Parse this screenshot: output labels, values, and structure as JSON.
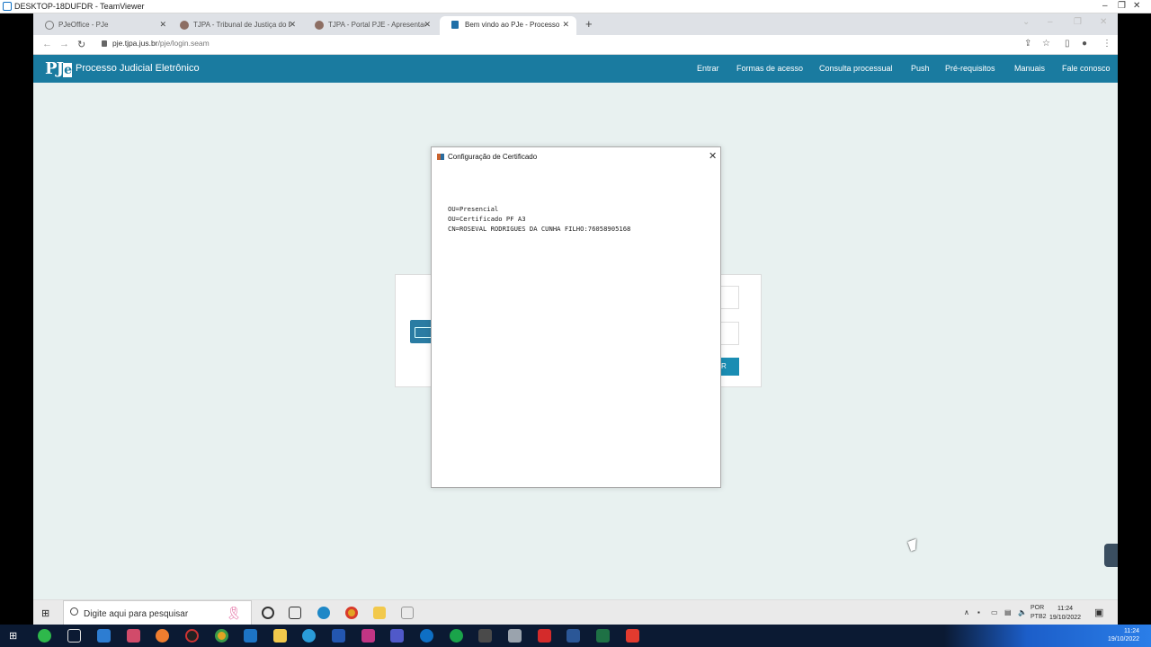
{
  "teamviewer": {
    "title": "DESKTOP-18DUFDR - TeamViewer",
    "controls": [
      "–",
      "❐",
      "✕"
    ]
  },
  "browser": {
    "tabs": [
      {
        "label": "PJeOffice - PJe",
        "favicon": "globe-icon",
        "active": false
      },
      {
        "label": "TJPA - Tribunal de Justiça do Esta",
        "favicon": "tjpa-icon",
        "active": false
      },
      {
        "label": "TJPA - Portal PJE - Apresentação",
        "favicon": "tjpa-icon",
        "active": false
      },
      {
        "label": "Bem vindo ao PJe - Processo Judi",
        "favicon": "pje-icon",
        "active": true
      }
    ],
    "new_tab": "+",
    "url_domain": "pje.tjpa.jus.br",
    "url_path": "/pje/login.seam"
  },
  "pje": {
    "logo": "PJ",
    "logo_suffix": "e",
    "title": "Processo Judicial Eletrônico",
    "nav": [
      "Entrar",
      "Formas de acesso",
      "Consulta processual",
      "Push",
      "Pré-requisitos",
      "Manuais",
      "Fale conosco"
    ],
    "login_button": "R"
  },
  "dialog": {
    "title": "Configuração de Certificado",
    "close": "✕",
    "lines": [
      "OU=Presencial",
      "OU=Certificado PF A3",
      "CN=ROSEVAL RODRIGUES DA CUNHA FILHO:76058905168"
    ]
  },
  "remote_taskbar": {
    "search_placeholder": "Digite aqui para pesquisar",
    "language": "POR",
    "layout": "PTB2",
    "time": "11:24",
    "date": "19/10/2022"
  },
  "local_taskbar": {
    "time": "11:24",
    "date": "19/10/2022"
  },
  "colors": {
    "pje_header": "#1a7ba0",
    "page_background": "#e8f1f0",
    "local_taskbar": "#0b1a33"
  }
}
